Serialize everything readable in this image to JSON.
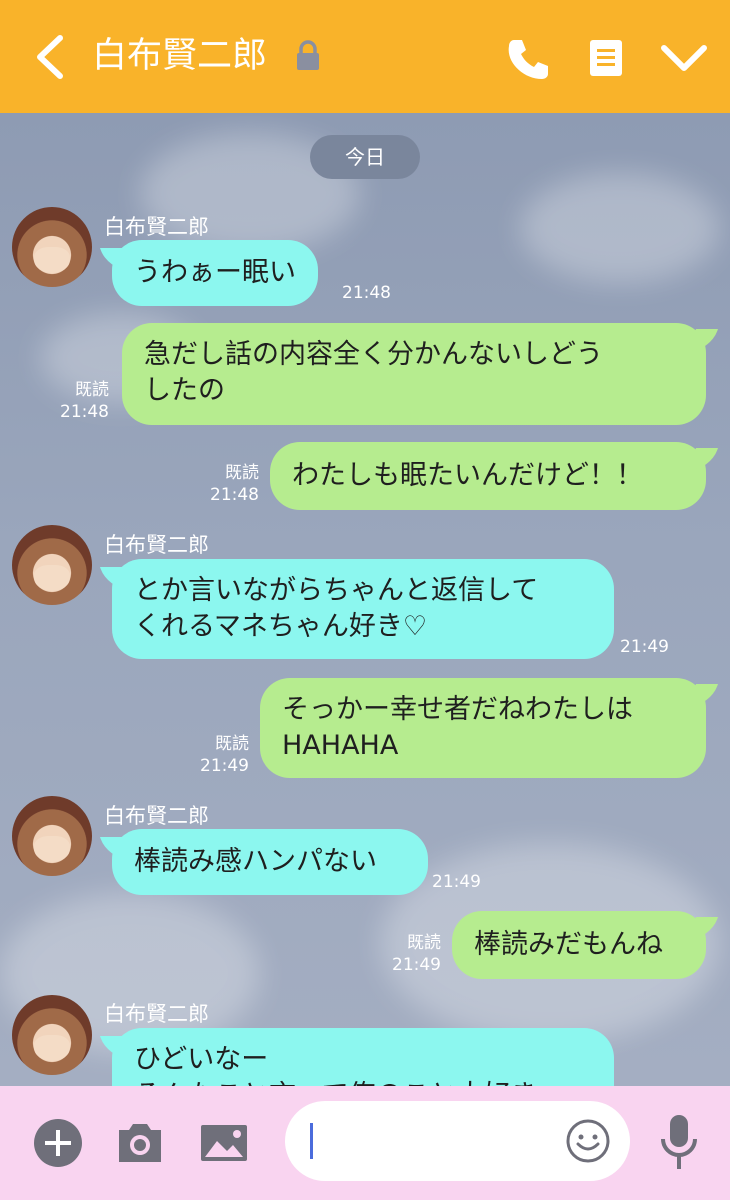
{
  "header": {
    "title": "白布賢二郎",
    "background": "#f9b32a",
    "icons": [
      "back-arrow-icon",
      "lock-icon",
      "phone-icon",
      "memo-icon",
      "chevron-down-icon"
    ]
  },
  "chat": {
    "date_label": "今日",
    "messages": [
      {
        "side": "in",
        "sender": "白布賢二郎",
        "lines": [
          "うわぁー眠い"
        ],
        "time": "21:48"
      },
      {
        "side": "out",
        "lines": [
          "急だし話の内容全く分かんないしどう",
          "したの"
        ],
        "read": "既読",
        "time": "21:48"
      },
      {
        "side": "out",
        "lines": [
          "わたしも眠たいんだけど！！"
        ],
        "read": "既読",
        "time": "21:48"
      },
      {
        "side": "in",
        "sender": "白布賢二郎",
        "lines": [
          "とか言いながらちゃんと返信して",
          "くれるマネちゃん好き♡"
        ],
        "time": "21:49"
      },
      {
        "side": "out",
        "lines": [
          "そっかー幸せ者だねわたしは",
          "HAHAHA"
        ],
        "read": "既読",
        "time": "21:49"
      },
      {
        "side": "in",
        "sender": "白布賢二郎",
        "lines": [
          "棒読み感ハンパない"
        ],
        "time": "21:49"
      },
      {
        "side": "out",
        "lines": [
          "棒読みだもんね"
        ],
        "read": "既読",
        "time": "21:49"
      },
      {
        "side": "in",
        "sender": "白布賢二郎",
        "lines": [
          "ひどいなー",
          "そんなこと言って俺のこと大好き"
        ],
        "time": ""
      }
    ]
  },
  "footer": {
    "background": "#f9d4f0",
    "input_value": "",
    "icons": [
      "plus-icon",
      "camera-icon",
      "image-icon",
      "smile-icon",
      "microphone-icon"
    ]
  },
  "colors": {
    "incoming_bubble": "#8cf7ef",
    "outgoing_bubble": "#b6ec8f",
    "cursor": "#4b6cdc"
  }
}
